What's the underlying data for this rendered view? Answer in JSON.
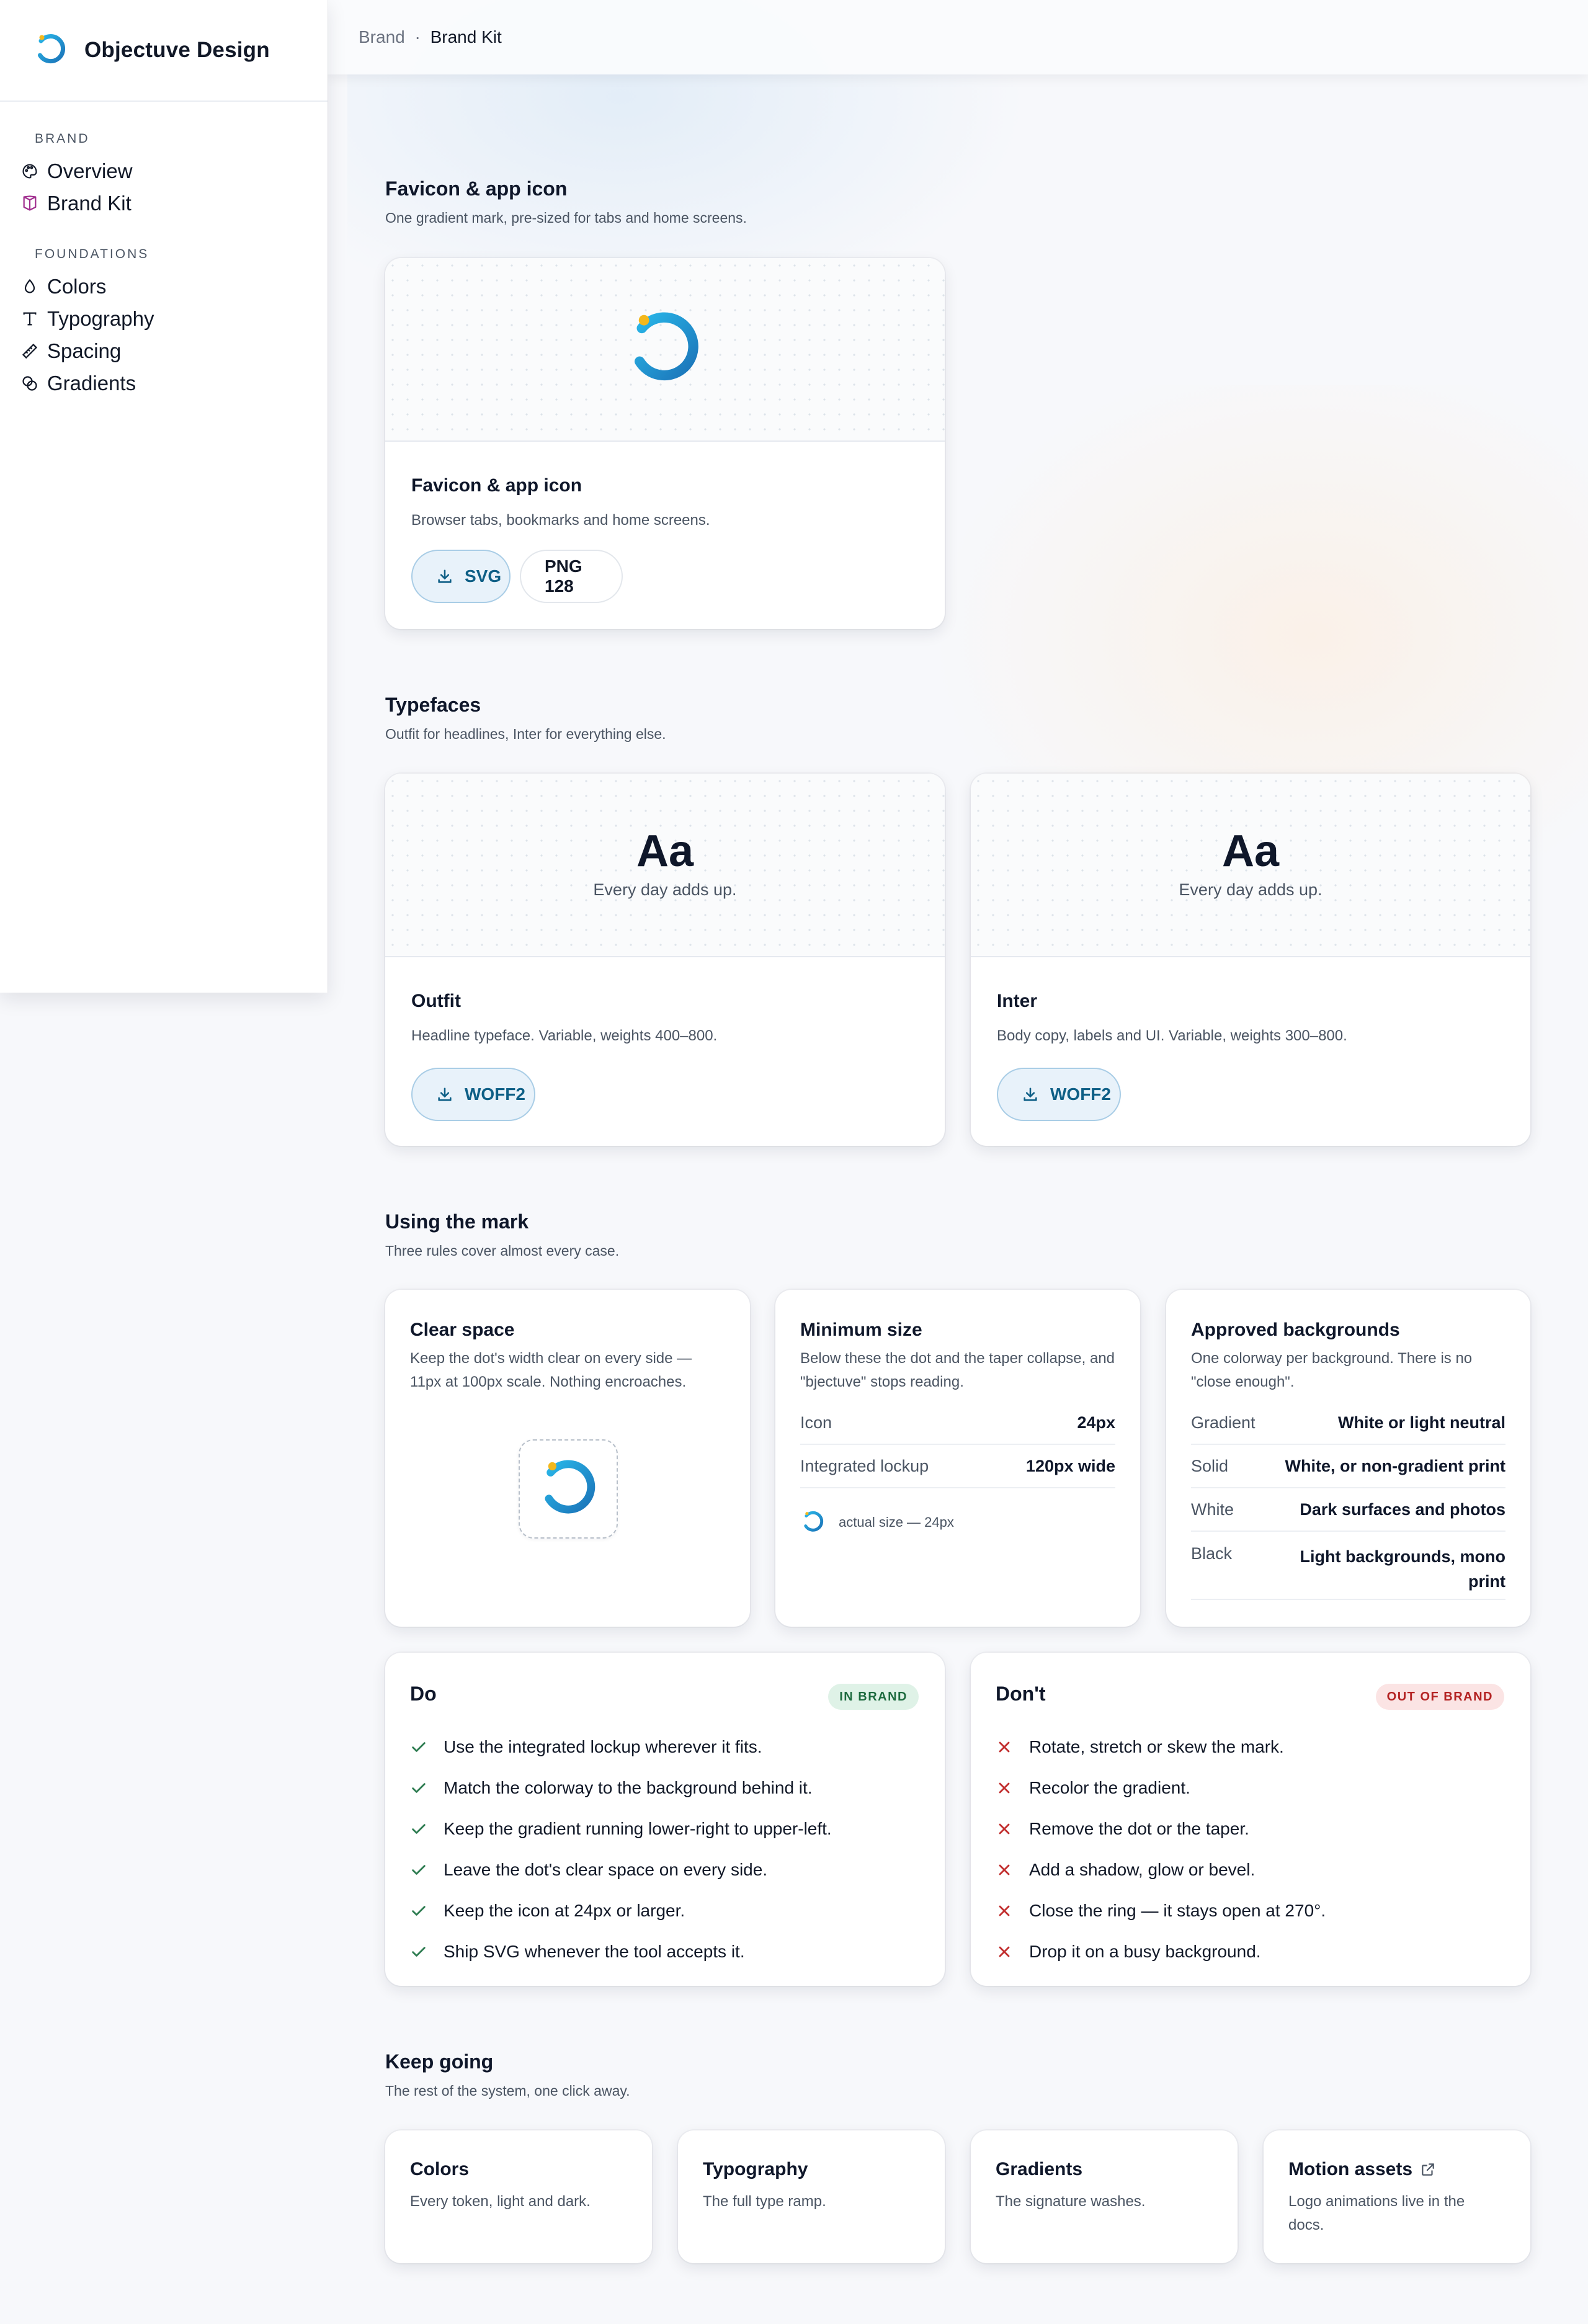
{
  "app": {
    "name": "Objectuve Design"
  },
  "sidebar": {
    "sections": [
      {
        "heading": "BRAND",
        "items": [
          {
            "label": "Overview",
            "icon": "palette-icon"
          },
          {
            "label": "Brand Kit",
            "icon": "box-icon",
            "active": true
          }
        ]
      },
      {
        "heading": "FOUNDATIONS",
        "items": [
          {
            "label": "Colors",
            "icon": "droplet-icon"
          },
          {
            "label": "Typography",
            "icon": "type-icon"
          },
          {
            "label": "Spacing",
            "icon": "ruler-icon"
          },
          {
            "label": "Gradients",
            "icon": "blend-icon"
          }
        ]
      }
    ]
  },
  "breadcrumb": {
    "parent": "Brand",
    "separator": "·",
    "current": "Brand Kit"
  },
  "favicon_section": {
    "title": "Favicon & app icon",
    "subtitle": "One gradient mark, pre-sized for tabs and home screens.",
    "card": {
      "title": "Favicon & app icon",
      "desc": "Browser tabs, bookmarks and home screens.",
      "buttons": [
        "SVG",
        "PNG 128"
      ]
    }
  },
  "typefaces_section": {
    "title": "Typefaces",
    "subtitle": "Outfit for headlines, Inter for everything else.",
    "cards": [
      {
        "sample": "Aa",
        "sample_text": "Every day adds up.",
        "title": "Outfit",
        "desc": "Headline typeface. Variable, weights 400–800.",
        "button": "WOFF2"
      },
      {
        "sample": "Aa",
        "sample_text": "Every day adds up.",
        "title": "Inter",
        "desc": "Body copy, labels and UI. Variable, weights 300–800.",
        "button": "WOFF2"
      }
    ]
  },
  "mark_section": {
    "title": "Using the mark",
    "subtitle": "Three rules cover almost every case.",
    "clear_space": {
      "title": "Clear space",
      "desc": "Keep the dot's width clear on every side — 11px at 100px scale. Nothing encroaches."
    },
    "min_size": {
      "title": "Minimum size",
      "desc": "Below these the dot and the taper collapse, and \"bjectuve\" stops reading.",
      "rows": [
        {
          "k": "Icon",
          "v": "24px"
        },
        {
          "k": "Integrated lockup",
          "v": "120px wide"
        }
      ],
      "actual": "actual size — 24px"
    },
    "backgrounds": {
      "title": "Approved backgrounds",
      "desc": "One colorway per background. There is no \"close enough\".",
      "rows": [
        {
          "k": "Gradient",
          "v": "White or light neutral"
        },
        {
          "k": "Solid",
          "v": "White, or non-gradient print"
        },
        {
          "k": "White",
          "v": "Dark surfaces and photos"
        },
        {
          "k": "Black",
          "v": "Light backgrounds, mono print"
        }
      ]
    }
  },
  "do_card": {
    "title": "Do",
    "badge": "IN BRAND",
    "items": [
      "Use the integrated lockup wherever it fits.",
      "Match the colorway to the background behind it.",
      "Keep the gradient running lower-right to upper-left.",
      "Leave the dot's clear space on every side.",
      "Keep the icon at 24px or larger.",
      "Ship SVG whenever the tool accepts it."
    ]
  },
  "dont_card": {
    "title": "Don't",
    "badge": "OUT OF BRAND",
    "items": [
      "Rotate, stretch or skew the mark.",
      "Recolor the gradient.",
      "Remove the dot or the taper.",
      "Add a shadow, glow or bevel.",
      "Close the ring — it stays open at 270°.",
      "Drop it on a busy background."
    ]
  },
  "keep_going": {
    "title": "Keep going",
    "subtitle": "The rest of the system, one click away.",
    "cards": [
      {
        "title": "Colors",
        "desc": "Every token, light and dark."
      },
      {
        "title": "Typography",
        "desc": "The full type ramp."
      },
      {
        "title": "Gradients",
        "desc": "The signature washes."
      },
      {
        "title": "Motion assets",
        "desc": "Logo animations live in the docs.",
        "icon": "external-link-icon"
      }
    ]
  },
  "colors": {
    "brand_blue": "#1e9bd7",
    "brand_blue_dark": "#1b73b8",
    "brand_gold": "#f4b81c",
    "active_nav": "#a12f8f",
    "check": "#2f7d52",
    "cross": "#c22e2e"
  }
}
